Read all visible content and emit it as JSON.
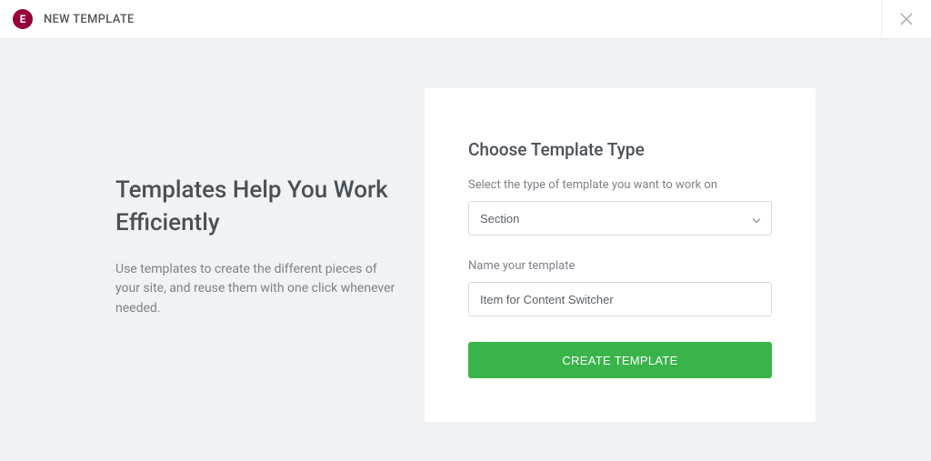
{
  "header": {
    "title": "NEW TEMPLATE"
  },
  "intro": {
    "heading": "Templates Help You Work Efficiently",
    "description": "Use templates to create the different pieces of your site, and reuse them with one click whenever needed."
  },
  "form": {
    "heading": "Choose Template Type",
    "type_label": "Select the type of template you want to work on",
    "type_value": "Section",
    "name_label": "Name your template",
    "name_value": "Item for Content Switcher",
    "submit_label": "CREATE TEMPLATE"
  }
}
